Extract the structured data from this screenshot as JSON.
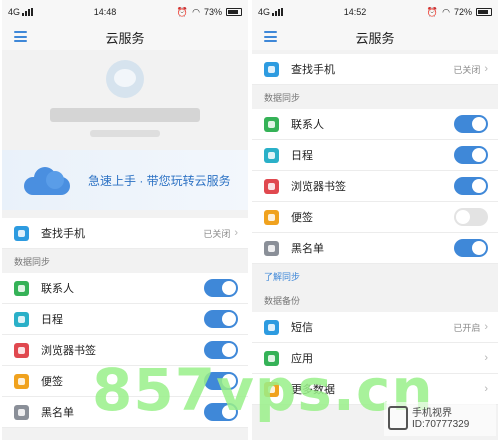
{
  "colors": {
    "accent": "#3f88d8",
    "toggle_off": "#e3e3e3",
    "watermark": "#9af08a"
  },
  "left_screen": {
    "status": {
      "network": "4G",
      "time": "14:48",
      "battery": "73%"
    },
    "title": "云服务",
    "menu_icon": "menu-icon",
    "banner_text": "急速上手 · 带您玩转云服务",
    "find_phone": {
      "label": "查找手机",
      "status": "已关闭",
      "icon_color": "#2d9be0"
    },
    "sync_section": "数据同步",
    "sync_items": [
      {
        "label": "联系人",
        "icon_color": "#35b257",
        "toggle": "on"
      },
      {
        "label": "日程",
        "icon_color": "#2ab0c8",
        "toggle": "on"
      },
      {
        "label": "浏览器书签",
        "icon_color": "#e0484f",
        "toggle": "on"
      },
      {
        "label": "便签",
        "icon_color": "#f0a21e",
        "toggle": "on"
      },
      {
        "label": "黑名单",
        "icon_color": "#8a8f98",
        "toggle": "on"
      }
    ]
  },
  "right_screen": {
    "status": {
      "network": "4G",
      "time": "14:52",
      "battery": "72%"
    },
    "title": "云服务",
    "find_phone": {
      "label": "查找手机",
      "status": "已关闭",
      "icon_color": "#2d9be0"
    },
    "sync_section": "数据同步",
    "sync_items": [
      {
        "label": "联系人",
        "icon_color": "#35b257",
        "toggle": "on"
      },
      {
        "label": "日程",
        "icon_color": "#2ab0c8",
        "toggle": "on"
      },
      {
        "label": "浏览器书签",
        "icon_color": "#e0484f",
        "toggle": "on"
      },
      {
        "label": "便签",
        "icon_color": "#f0a21e",
        "toggle": "off"
      },
      {
        "label": "黑名单",
        "icon_color": "#8a8f98",
        "toggle": "on"
      }
    ],
    "learn_link": "了解同步",
    "backup_section": "数据备份",
    "backup_items": [
      {
        "label": "短信",
        "icon_color": "#2d9be0",
        "status": "已开启"
      },
      {
        "label": "应用",
        "icon_color": "#35b257",
        "status": ""
      },
      {
        "label": "更多数据",
        "icon_color": "#f0a21e",
        "status": ""
      }
    ]
  },
  "watermark": "857vps.cn",
  "stamp": {
    "line1": "手机视界",
    "line2": "ID:70777329"
  }
}
